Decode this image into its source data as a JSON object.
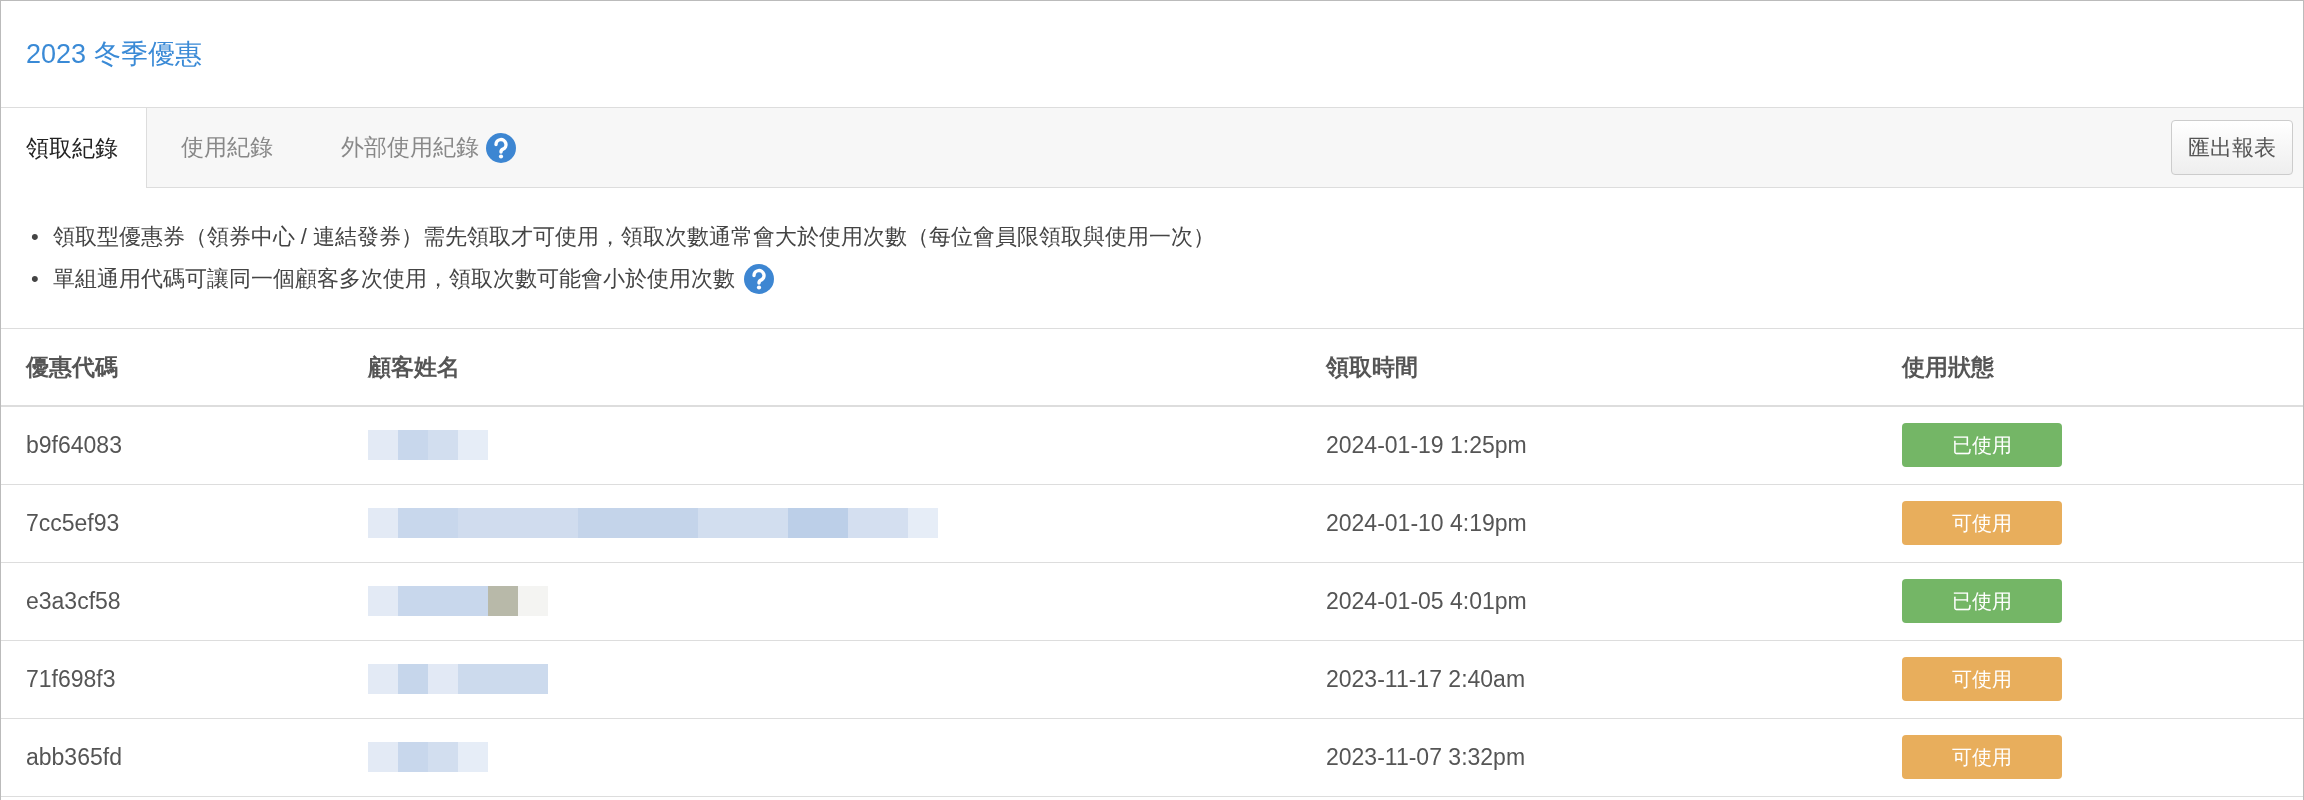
{
  "title": "2023 冬季優惠",
  "tabs": [
    {
      "label": "領取紀錄",
      "selected": true,
      "help": false
    },
    {
      "label": "使用紀錄",
      "selected": false,
      "help": false
    },
    {
      "label": "外部使用紀錄",
      "selected": false,
      "help": true
    }
  ],
  "export_button": "匯出報表",
  "notes": [
    {
      "bullet": "•",
      "text": "領取型優惠券（領券中心 / 連結發券）需先領取才可使用，領取次數通常會大於使用次數（每位會員限領取與使用一次）",
      "help": false
    },
    {
      "bullet": "•",
      "text": "單組通用代碼可讓同一個顧客多次使用，領取次數可能會小於使用次數",
      "help": true
    }
  ],
  "table": {
    "columns": [
      "優惠代碼",
      "顧客姓名",
      "領取時間",
      "使用狀態"
    ],
    "rows": [
      {
        "code": "b9f64083",
        "time": "2024-01-19 1:25pm",
        "status": {
          "label": "已使用",
          "kind": "used"
        }
      },
      {
        "code": "7cc5ef93",
        "time": "2024-01-10 4:19pm",
        "status": {
          "label": "可使用",
          "kind": "available"
        }
      },
      {
        "code": "e3a3cf58",
        "time": "2024-01-05 4:01pm",
        "status": {
          "label": "已使用",
          "kind": "used"
        }
      },
      {
        "code": "71f698f3",
        "time": "2023-11-17 2:40am",
        "status": {
          "label": "可使用",
          "kind": "available"
        }
      },
      {
        "code": "abb365fd",
        "time": "2023-11-07 3:32pm",
        "status": {
          "label": "可使用",
          "kind": "available"
        }
      }
    ]
  }
}
